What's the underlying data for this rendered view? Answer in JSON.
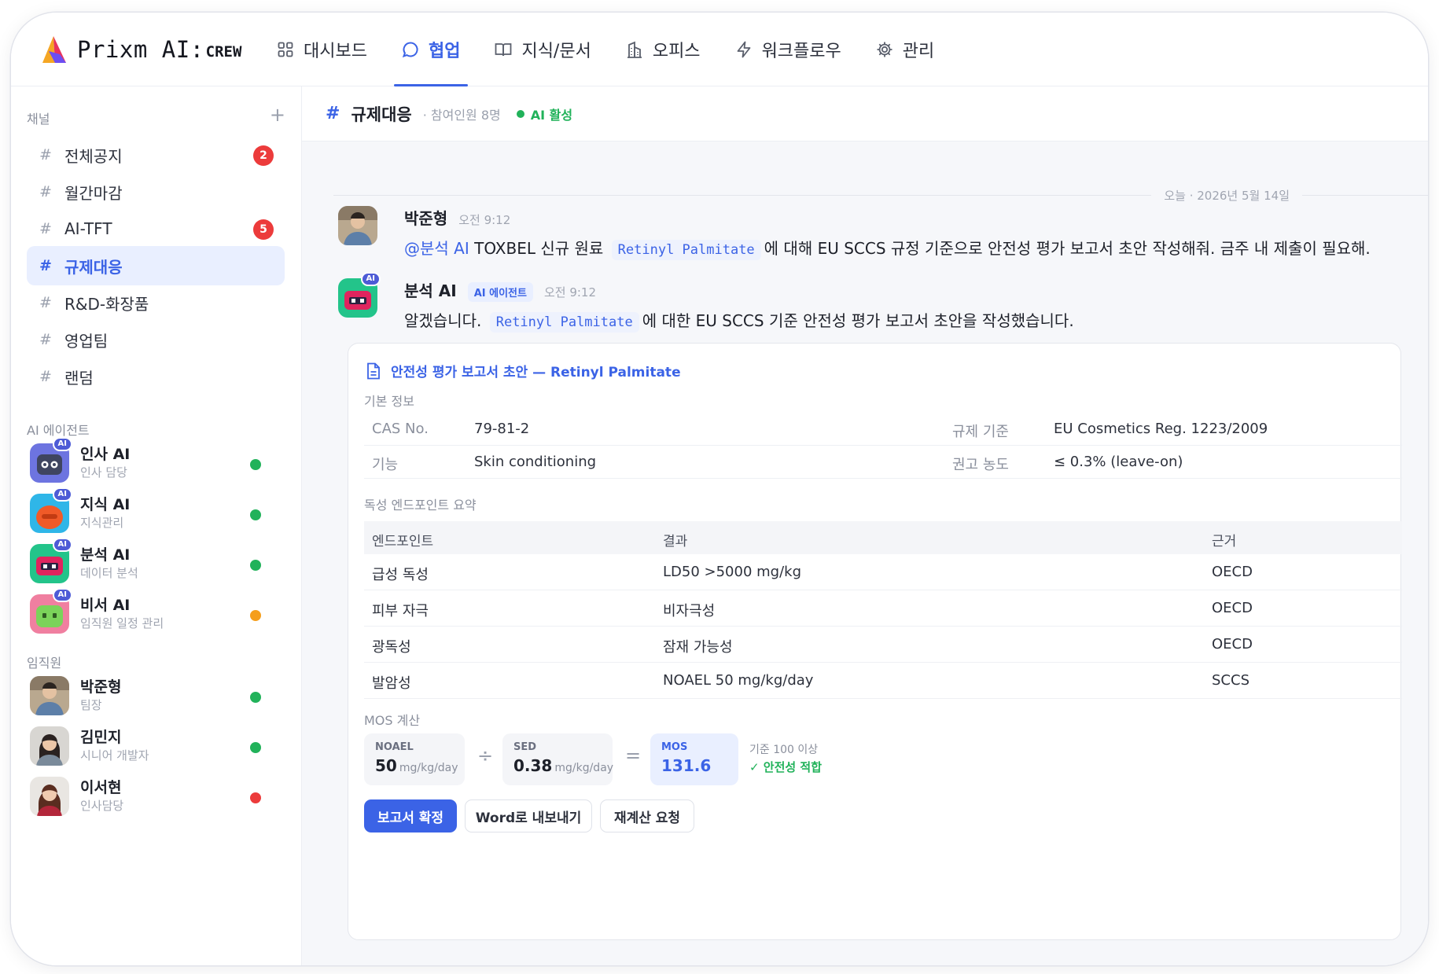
{
  "brand": {
    "name": "Prixm AI:",
    "sub": "CREW"
  },
  "nav": {
    "tabs": [
      {
        "label": "대시보드",
        "icon": "grid-icon"
      },
      {
        "label": "협업",
        "icon": "chat-icon"
      },
      {
        "label": "지식/문서",
        "icon": "book-icon"
      },
      {
        "label": "오피스",
        "icon": "building-icon"
      },
      {
        "label": "워크플로우",
        "icon": "lightning-icon"
      },
      {
        "label": "관리",
        "icon": "gear-icon"
      }
    ],
    "active_index": 1
  },
  "sidebar": {
    "channels_title": "채널",
    "add_label": "+",
    "channels": [
      {
        "name": "전체공지",
        "badge": "2"
      },
      {
        "name": "월간마감",
        "badge": ""
      },
      {
        "name": "AI-TFT",
        "badge": "5"
      },
      {
        "name": "규제대응",
        "badge": ""
      },
      {
        "name": "R&D-화장품",
        "badge": ""
      },
      {
        "name": "영업팀",
        "badge": ""
      },
      {
        "name": "랜덤",
        "badge": ""
      }
    ],
    "active_channel": 3,
    "agents_title": "AI 에이전트",
    "agents": [
      {
        "name": "인사 AI",
        "role": "인사 담당",
        "status": "online",
        "color": "#5b6bd8"
      },
      {
        "name": "지식 AI",
        "role": "지식관리",
        "status": "online",
        "color": "#2fb6e8"
      },
      {
        "name": "분석 AI",
        "role": "데이터 분석",
        "status": "online",
        "color": "#23c48a"
      },
      {
        "name": "비서 AI",
        "role": "임직원 일정 관리",
        "status": "away",
        "color": "#7bd35a"
      }
    ],
    "ai_tag": "AI",
    "staff_title": "임직원",
    "staff": [
      {
        "name": "박준형",
        "role": "팀장",
        "status": "online"
      },
      {
        "name": "김민지",
        "role": "시니어 개발자",
        "status": "online"
      },
      {
        "name": "이서현",
        "role": "인사담당",
        "status": "busy"
      }
    ]
  },
  "status_colors": {
    "online": "#21b25a",
    "away": "#f59e1b",
    "busy": "#ec3b3b"
  },
  "channel_header": {
    "hash": "#",
    "title": "규제대응",
    "members": "· 참여인원 8명",
    "ai_status": "AI 활성"
  },
  "date_divider": "오늘 · 2026년 5월 14일",
  "messages": [
    {
      "author": "박준형",
      "time": "오전 9:12",
      "mention": "@분석 AI",
      "text_before": "TOXBEL 신규 원료",
      "code": "Retinyl Palmitate",
      "text_after": "에 대해 EU SCCS 규정 기준으로 안전성 평가 보고서 초안 작성해줘. 금주 내 제출이 필요해."
    },
    {
      "author": "분석 AI",
      "pill": "AI 에이전트",
      "time": "오전 9:12",
      "text_before": "알겠습니다.",
      "code": "Retinyl Palmitate",
      "text_after": "에 대한 EU SCCS 기준 안전성 평가 보고서 초안을 작성했습니다."
    }
  ],
  "report": {
    "title": "안전성 평가 보고서 초안 — Retinyl Palmitate",
    "basic_title": "기본 정보",
    "basic": [
      {
        "k1": "CAS No.",
        "v1": "79-81-2",
        "k2": "규제 기준",
        "v2": "EU Cosmetics Reg. 1223/2009"
      },
      {
        "k1": "기능",
        "v1": "Skin conditioning",
        "k2": "권고 농도",
        "v2": "≤ 0.3% (leave-on)"
      }
    ],
    "tox_title": "독성 엔드포인트 요약",
    "tox_headers": [
      "엔드포인트",
      "결과",
      "근거"
    ],
    "tox_rows": [
      [
        "급성 독성",
        "LD50 >5000 mg/kg",
        "OECD"
      ],
      [
        "피부 자극",
        "비자극성",
        "OECD"
      ],
      [
        "광독성",
        "잠재 가능성",
        "OECD"
      ],
      [
        "발암성",
        "NOAEL 50 mg/kg/day",
        "SCCS"
      ]
    ],
    "mos_title": "MOS 계산",
    "noael": {
      "label": "NOAEL",
      "value": "50",
      "unit": "mg/kg/day"
    },
    "sed": {
      "label": "SED",
      "value": "0.38",
      "unit": "mg/kg/day"
    },
    "mos": {
      "label": "MOS",
      "value": "131.6"
    },
    "op_div": "÷",
    "op_eq": "=",
    "criterion": "기준 100 이상",
    "verdict": "✓ 안전성 적합",
    "buttons": {
      "confirm": "보고서 확정",
      "export": "Word로 내보내기",
      "recalc": "재계산 요청"
    }
  }
}
